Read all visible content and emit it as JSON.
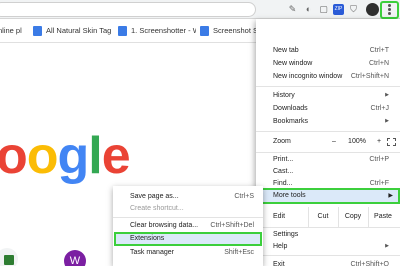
{
  "toolbar": {
    "extension_icons": [
      "pen-icon",
      "paint-icon",
      "lock-icon",
      "zip-icon",
      "shield-icon",
      "gear-icon"
    ],
    "zip_label": "ZIP",
    "colors": {
      "highlight": "#3ccf3c"
    }
  },
  "bookmarks": [
    {
      "label": "nline pl",
      "color": "#4a4a4a"
    },
    {
      "label": "All Natural Skin Tag",
      "color": "#3b7be6"
    },
    {
      "label": "1. Screenshotter - W",
      "color": "#3b7be6"
    },
    {
      "label": "Screenshot St",
      "color": "#3b7be6"
    }
  ],
  "page": {
    "logo_letters": [
      "o",
      "o",
      "g",
      "l",
      "e"
    ],
    "logo_colors": [
      "#ea4335",
      "#fbbc05",
      "#4285f4",
      "#34a853",
      "#ea4335"
    ],
    "tile_letter": "W"
  },
  "menu": {
    "new_tab": {
      "label": "New tab",
      "shortcut": "Ctrl+T"
    },
    "new_window": {
      "label": "New window",
      "shortcut": "Ctrl+N"
    },
    "new_incognito": {
      "label": "New incognito window",
      "shortcut": "Ctrl+Shift+N"
    },
    "history": {
      "label": "History"
    },
    "downloads": {
      "label": "Downloads",
      "shortcut": "Ctrl+J"
    },
    "bookmarks": {
      "label": "Bookmarks"
    },
    "zoom": {
      "label": "Zoom",
      "minus": "–",
      "value": "100%",
      "plus": "+"
    },
    "print": {
      "label": "Print...",
      "shortcut": "Ctrl+P"
    },
    "cast": {
      "label": "Cast..."
    },
    "find": {
      "label": "Find...",
      "shortcut": "Ctrl+F"
    },
    "more_tools": {
      "label": "More tools"
    },
    "edit": {
      "label": "Edit",
      "cut": "Cut",
      "copy": "Copy",
      "paste": "Paste"
    },
    "settings": {
      "label": "Settings"
    },
    "help": {
      "label": "Help"
    },
    "exit": {
      "label": "Exit",
      "shortcut": "Ctrl+Shift+Q"
    }
  },
  "submenu": {
    "save_page": {
      "label": "Save page as...",
      "shortcut": "Ctrl+S"
    },
    "create_shortcut": {
      "label": "Create shortcut..."
    },
    "clear_browsing": {
      "label": "Clear browsing data...",
      "shortcut": "Ctrl+Shift+Del"
    },
    "extensions": {
      "label": "Extensions"
    },
    "task_manager": {
      "label": "Task manager",
      "shortcut": "Shift+Esc"
    }
  }
}
